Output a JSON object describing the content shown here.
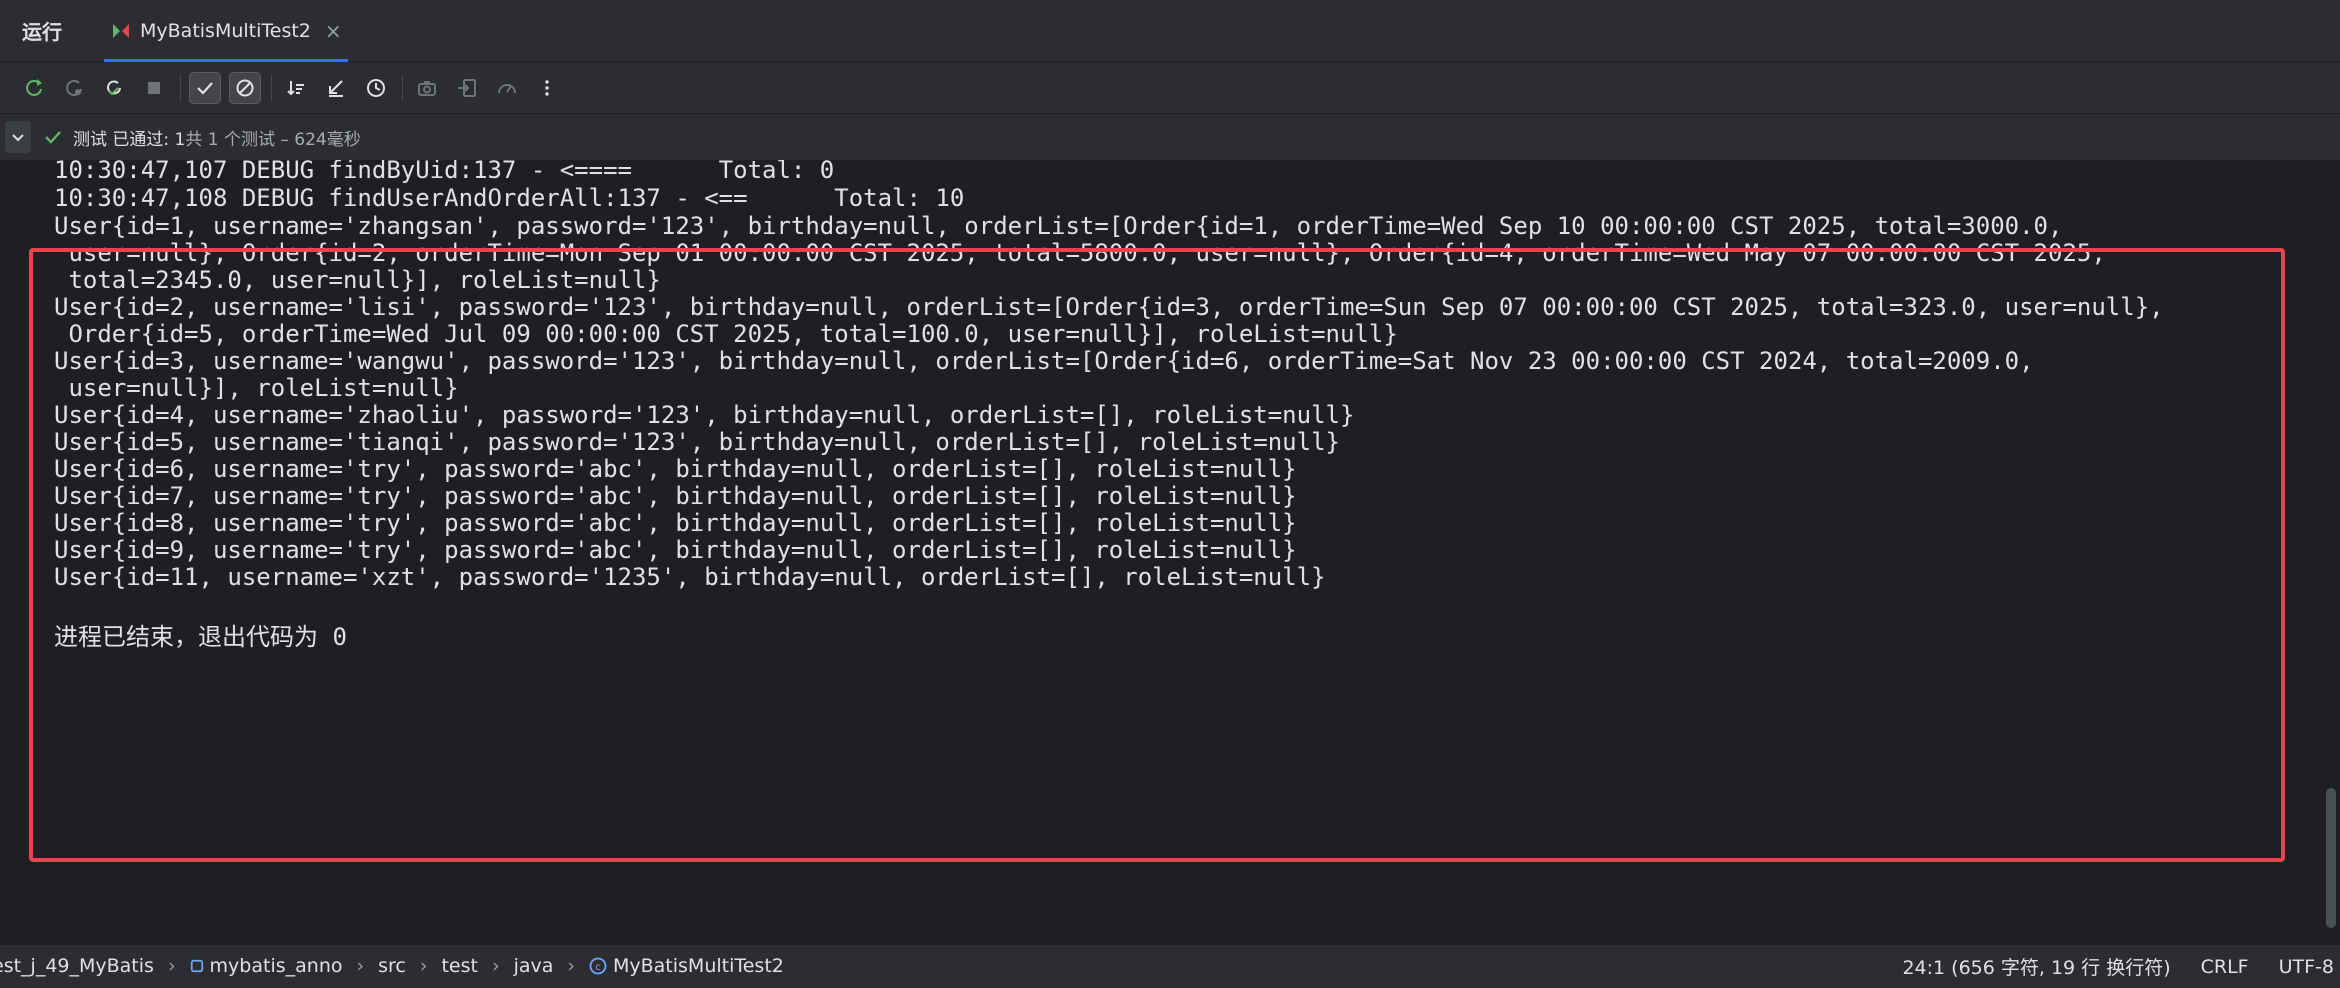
{
  "header": {
    "title": "运行",
    "tab": {
      "label": "MyBatisMultiTest2"
    }
  },
  "status": {
    "passed": "测试 已通过: 1",
    "detail": "共 1 个测试 – 624毫秒"
  },
  "console": {
    "lines": [
      "10:30:47,107 DEBUG findByUid:137 - <====      Total: 0",
      "10:30:47,108 DEBUG findUserAndOrderAll:137 - <==      Total: 10",
      "User{id=1, username='zhangsan', password='123', birthday=null, orderList=[Order{id=1, orderTime=Wed Sep 10 00:00:00 CST 2025, total=3000.0,",
      " user=null}, Order{id=2, orderTime=Mon Sep 01 00:00:00 CST 2025, total=5800.0, user=null}, Order{id=4, orderTime=Wed May 07 00:00:00 CST 2025,",
      " total=2345.0, user=null}], roleList=null}",
      "User{id=2, username='lisi', password='123', birthday=null, orderList=[Order{id=3, orderTime=Sun Sep 07 00:00:00 CST 2025, total=323.0, user=null},",
      " Order{id=5, orderTime=Wed Jul 09 00:00:00 CST 2025, total=100.0, user=null}], roleList=null}",
      "User{id=3, username='wangwu', password='123', birthday=null, orderList=[Order{id=6, orderTime=Sat Nov 23 00:00:00 CST 2024, total=2009.0,",
      " user=null}], roleList=null}",
      "User{id=4, username='zhaoliu', password='123', birthday=null, orderList=[], roleList=null}",
      "User{id=5, username='tianqi', password='123', birthday=null, orderList=[], roleList=null}",
      "User{id=6, username='try', password='abc', birthday=null, orderList=[], roleList=null}",
      "User{id=7, username='try', password='abc', birthday=null, orderList=[], roleList=null}",
      "User{id=8, username='try', password='abc', birthday=null, orderList=[], roleList=null}",
      "User{id=9, username='try', password='abc', birthday=null, orderList=[], roleList=null}",
      "User{id=11, username='xzt', password='1235', birthday=null, orderList=[], roleList=null}",
      "进程已结束，退出代码为 0"
    ]
  },
  "breadcrumb": {
    "items": [
      "est_j_49_MyBatis",
      "mybatis_anno",
      "src",
      "test",
      "java",
      "MyBatisMultiTest2"
    ]
  },
  "statusbar": {
    "position": "24:1 (656 字符, 19 行 换行符)",
    "line_ending": "CRLF",
    "encoding": "UTF-8"
  },
  "colors": {
    "highlight": "#e5464d",
    "pass_green": "#5fb865",
    "accent": "#3574f0"
  }
}
